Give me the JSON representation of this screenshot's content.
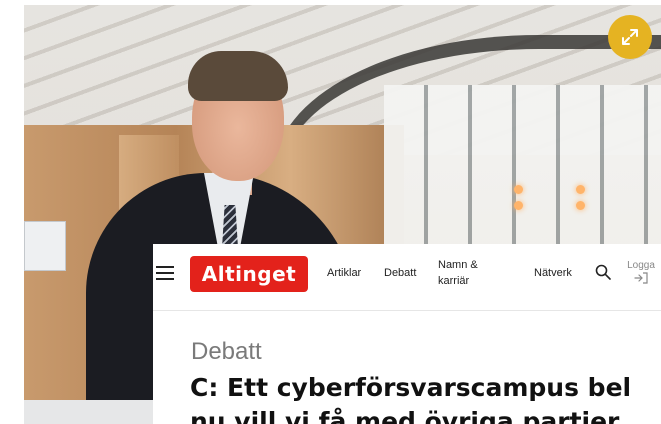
{
  "background_photo": {
    "description": "Man in dark suit smiling in a building interior"
  },
  "expand_button": {
    "icon": "expand-arrows-icon",
    "color": "#e5b322"
  },
  "header": {
    "logo": {
      "text": "Altinget",
      "color": "#e3221b"
    },
    "menu_icon": "hamburger-menu-icon",
    "nav": {
      "artiklar": "Artiklar",
      "debatt": "Debatt",
      "namn_karriar": "Namn & karriär",
      "natverk": "Nätverk"
    },
    "search_icon": "search-icon",
    "login": {
      "label": "Logga",
      "icon": "login-arrow-icon"
    }
  },
  "article": {
    "section": "Debatt",
    "headline_line1": "C: Ett cyberförsvarscampus bel",
    "headline_line2": "nu vill vi få med övriga partier"
  }
}
